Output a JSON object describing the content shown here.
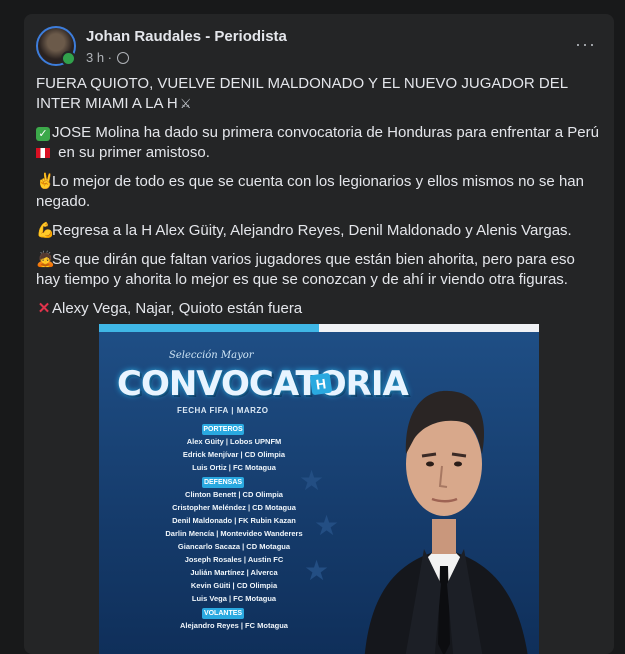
{
  "post": {
    "author": "Johan Raudales - Periodista",
    "time": "3 h ·",
    "more_label": "···",
    "paragraphs": [
      {
        "emoji": "",
        "text": "FUERA QUIOTO, VUELVE DENIL MALDONADO  Y EL NUEVO JUGADOR DEL INTER MIAMI A LA H",
        "trail": "swords"
      },
      {
        "emoji": "check",
        "text": "JOSE Molina ha dado su primera convocatoria de Honduras para enfrentar a Perú ",
        "flag": true,
        "text2": " en su primer amistoso."
      },
      {
        "emoji": "victory",
        "text": "Lo mejor de todo es que se cuenta con los legionarios y ellos mismos no se han negado."
      },
      {
        "emoji": "muscle",
        "text": "Regresa a la H Alex Güity, Alejandro Reyes, Denil Maldonado y Alenis Vargas."
      },
      {
        "emoji": "person",
        "text": "Se que dirán que faltan varios jugadores que están bien ahorita, pero para eso hay tiempo y ahorita lo mejor es que se conozcan y de ahí ir viendo otra figuras."
      },
      {
        "emoji": "x",
        "text": "Alexy Vega, Najar, Quioto están fuera"
      }
    ]
  },
  "graphic": {
    "selection": "Selección Mayor",
    "title": "CONVOCATORIA",
    "badge": "H",
    "fecha": "FECHA FIFA  |  MARZO",
    "sections": {
      "porteros": "PORTEROS",
      "defensas": "DEFENSAS",
      "volantes": "VOLANTES"
    },
    "porteros": [
      "Alex Güity  |  Lobos UPNFM",
      "Edrick Menjívar  |  CD Olimpia",
      "Luis Ortiz  |  FC Motagua"
    ],
    "defensas": [
      "Clinton Benett  |  CD Olimpia",
      "Cristopher Meléndez  |  CD Motagua",
      "Denil Maldonado  |  FK Rubin Kazan",
      "Darlin Mencía  |  Montevideo Wanderers",
      "Giancarlo Sacaza  |  CD Motagua",
      "Joseph Rosales  |  Austin FC",
      "Julián Martínez  |  Alverca",
      "Kevin Güiti  |  CD Olimpia",
      "Luis Vega  |  FC Motagua"
    ],
    "volantes": [
      "Alejandro Reyes  |  FC Motagua"
    ]
  }
}
